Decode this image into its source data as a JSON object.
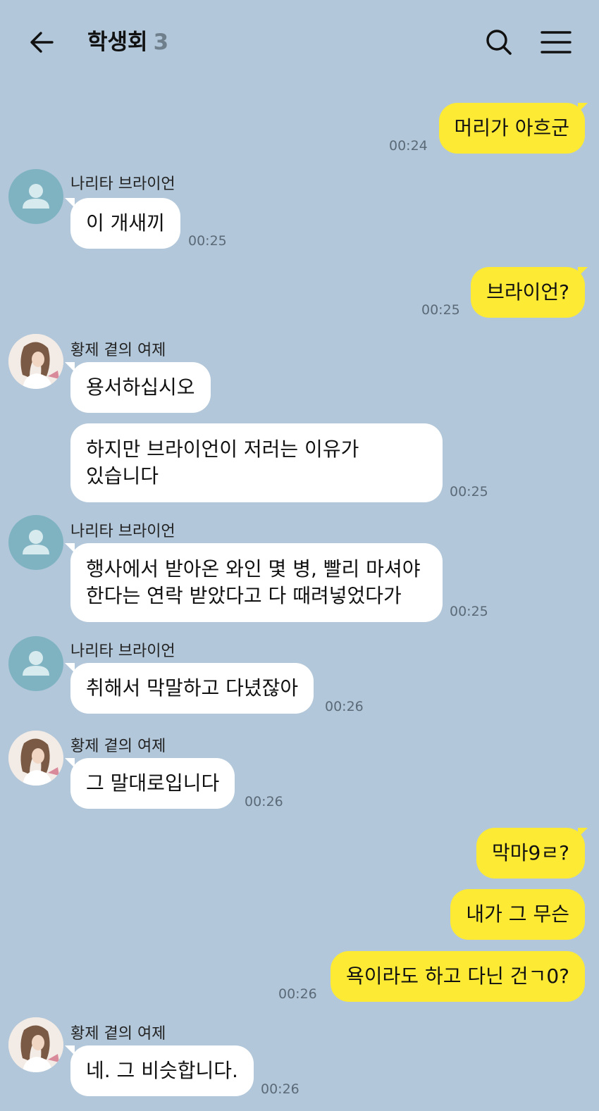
{
  "header": {
    "title": "학생회",
    "member_count": "3",
    "back_icon": "arrow-left-icon",
    "search_icon": "search-icon",
    "menu_icon": "menu-icon"
  },
  "colors": {
    "background": "#b2c7d9",
    "my_bubble": "#fdea34",
    "other_bubble": "#ffffff",
    "default_avatar": "#7fb3c2"
  },
  "messages": [
    {
      "type": "mine",
      "text": "머리가 아흐군",
      "time": "00:24"
    },
    {
      "type": "other",
      "sender": "나리타 브라이언",
      "text": "이 개새끼",
      "time": "00:25"
    },
    {
      "type": "mine",
      "text": "브라이언?",
      "time": "00:25"
    },
    {
      "type": "other",
      "sender": "황제 곁의 여제",
      "text": "용서하십시오"
    },
    {
      "type": "other",
      "lines": [
        "하지만 브라이언이 저러는 이유가",
        "있습니다"
      ],
      "time": "00:25"
    },
    {
      "type": "other",
      "sender": "나리타 브라이언",
      "lines": [
        "행사에서 받아온 와인 몇 병, 빨리 마셔야",
        "한다는 연락 받았다고 다 때려넣었다가"
      ],
      "time": "00:25"
    },
    {
      "type": "other",
      "sender": "나리타 브라이언",
      "text": "취해서 막말하고 다녔잖아",
      "time": "00:26"
    },
    {
      "type": "other",
      "sender": "황제 곁의 여제",
      "text": "그 말대로입니다",
      "time": "00:26"
    },
    {
      "type": "mine",
      "text": "막마9ㄹ?"
    },
    {
      "type": "mine",
      "text": "내가 그 무슨"
    },
    {
      "type": "mine",
      "text": "욕이라도 하고 다닌 건ㄱ0?",
      "time": "00:26"
    },
    {
      "type": "other",
      "sender": "황제 곁의 여제",
      "text": "네. 그 비슷합니다.",
      "time": "00:26"
    }
  ]
}
